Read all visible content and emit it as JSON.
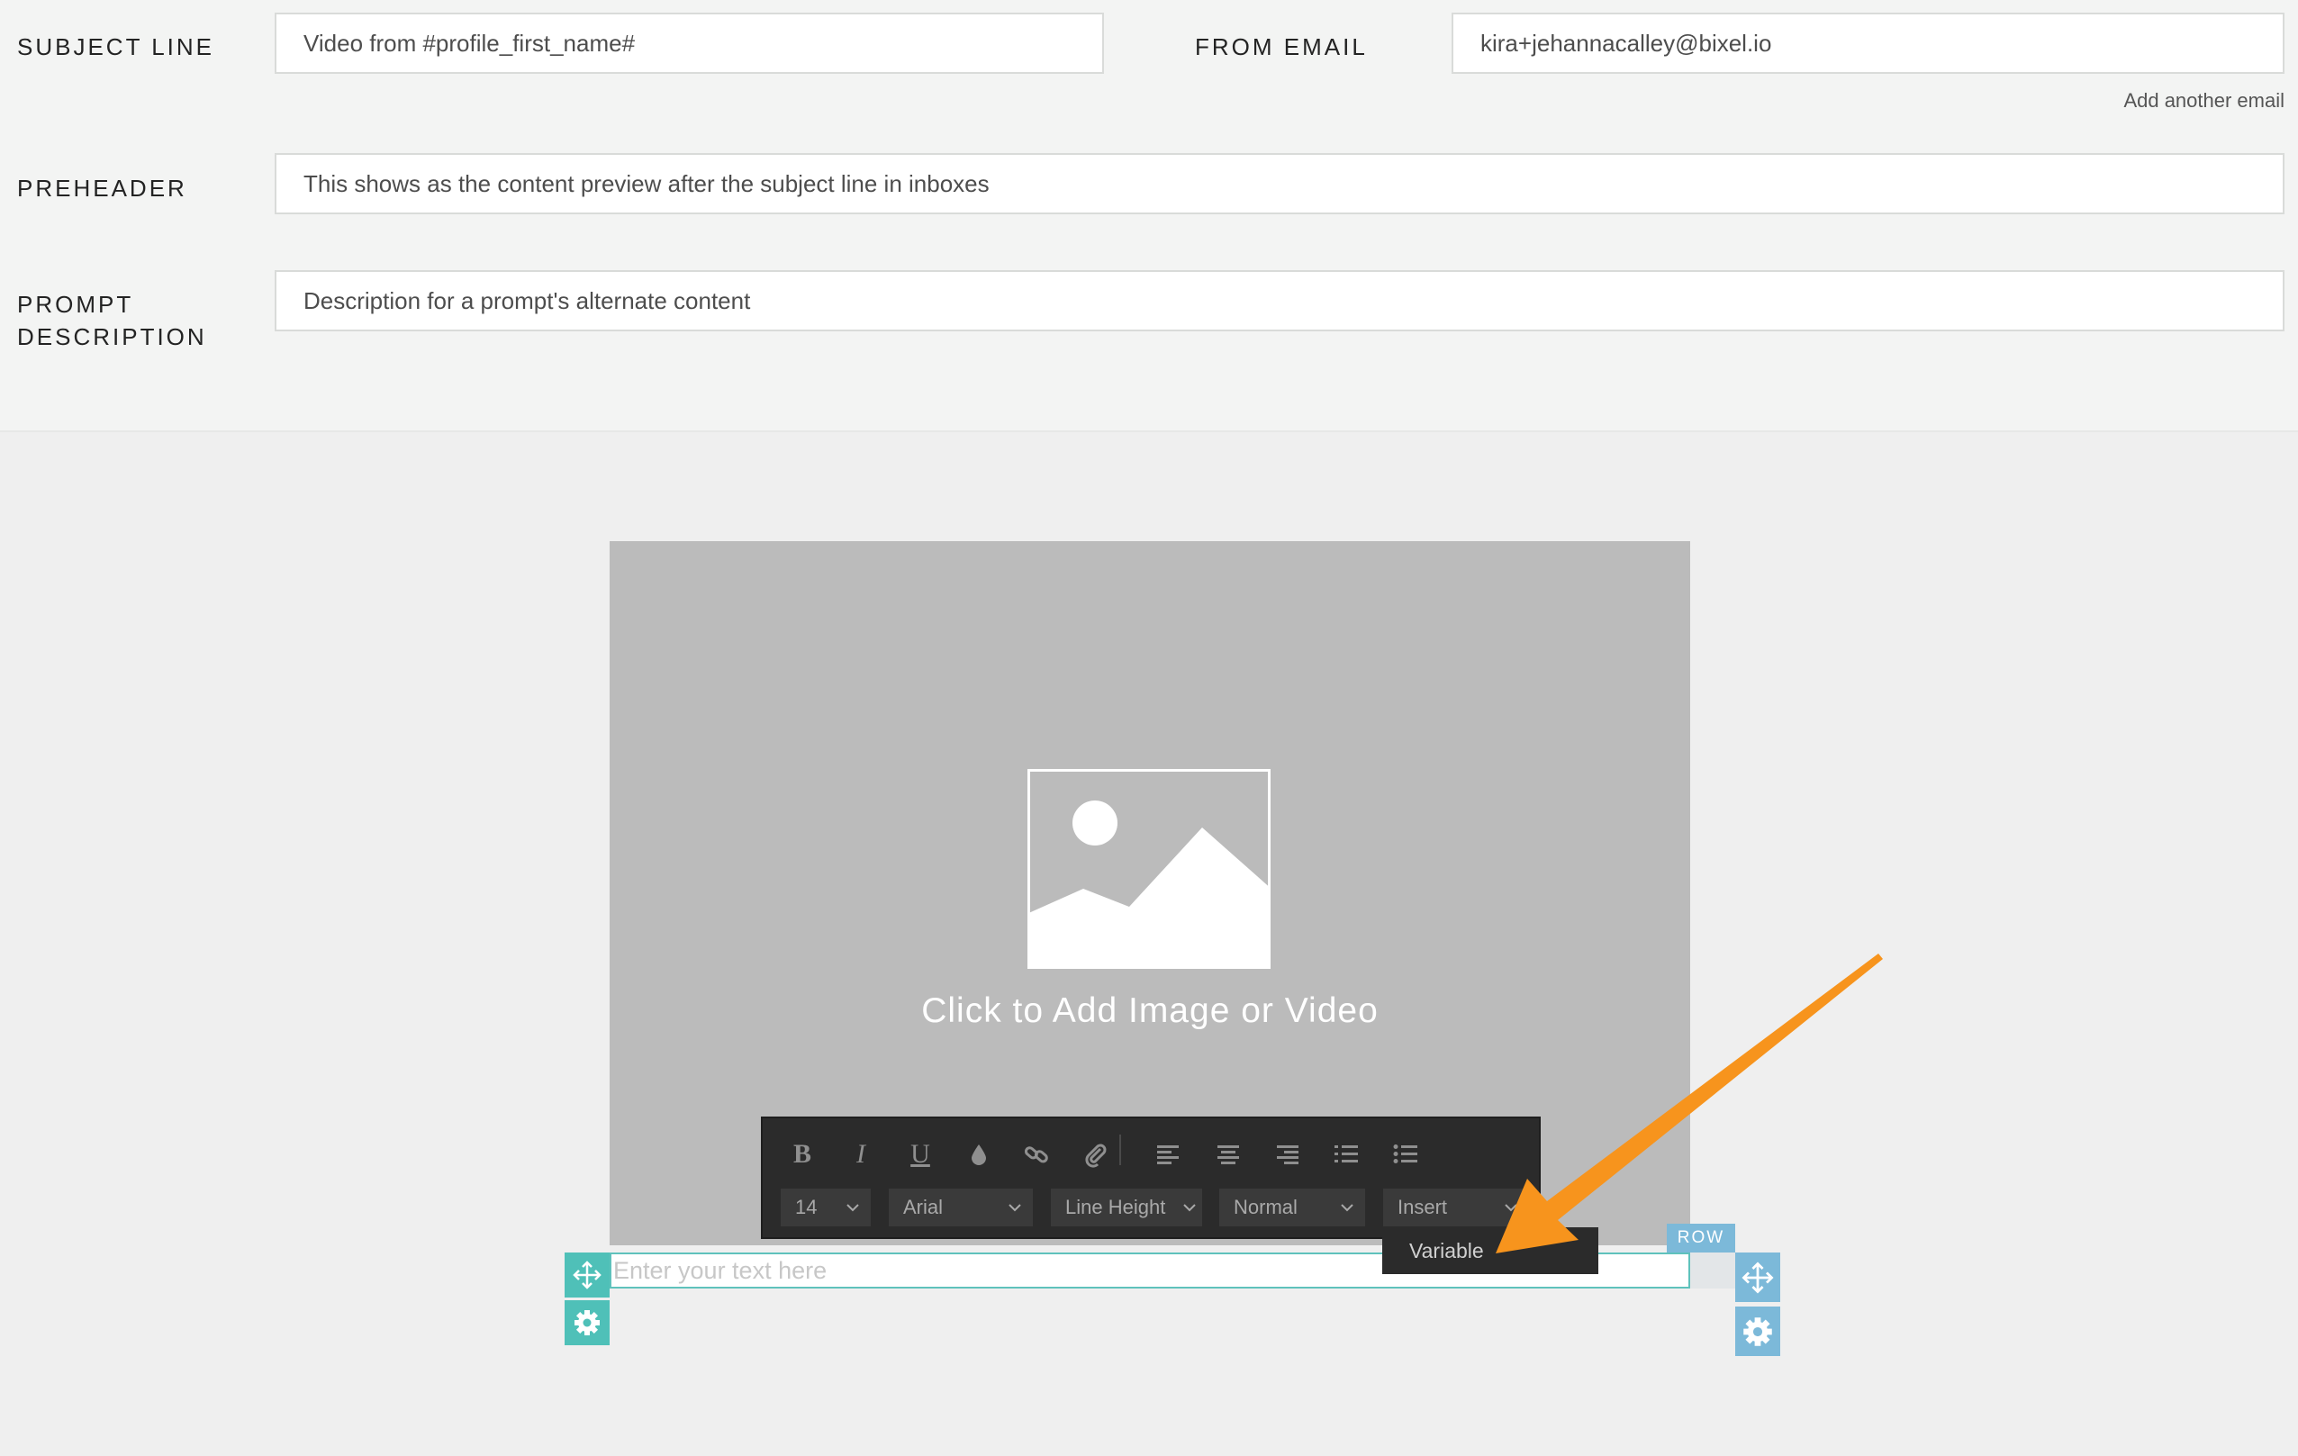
{
  "form": {
    "subject_line": {
      "label": "SUBJECT LINE",
      "value": "Video from #profile_first_name#"
    },
    "from_email": {
      "label": "FROM EMAIL",
      "value": "kira+jehannacalley@bixel.io",
      "add_link": "Add another email"
    },
    "preheader": {
      "label": "PREHEADER",
      "value": "This shows as the content preview after the subject line in inboxes"
    },
    "prompt_description": {
      "label_line1": "PROMPT",
      "label_line2": "DESCRIPTION",
      "value": "Description for a prompt's alternate content"
    }
  },
  "canvas": {
    "image_block": {
      "caption": "Click to Add Image or Video",
      "icon": "image-placeholder-icon"
    },
    "text_block": {
      "placeholder": "Enter your text here"
    },
    "row_tag": "ROW"
  },
  "toolbar": {
    "buttons": [
      {
        "icon": "bold-icon",
        "glyph": "B"
      },
      {
        "icon": "italic-icon",
        "glyph": "I"
      },
      {
        "icon": "underline-icon",
        "glyph": "U"
      },
      {
        "icon": "text-color-icon"
      },
      {
        "icon": "link-icon"
      },
      {
        "icon": "attachment-icon"
      },
      {
        "icon": "align-left-icon"
      },
      {
        "icon": "align-center-icon"
      },
      {
        "icon": "align-right-icon"
      },
      {
        "icon": "ordered-list-icon"
      },
      {
        "icon": "bulleted-list-icon"
      }
    ],
    "font_size": "14",
    "font_family": "Arial",
    "line_height": "Line Height",
    "paragraph_style": "Normal",
    "insert": "Insert",
    "insert_menu": {
      "items": [
        "Variable"
      ]
    }
  },
  "annotation": {
    "color": "#f7941d",
    "icon": "pointer-arrow-annotation"
  },
  "colors": {
    "accent_teal": "#4fc0b8",
    "accent_blue": "#7cb9d9",
    "toolbar_bg": "#2b2b2b",
    "image_placeholder_bg": "#bbbbbb"
  }
}
